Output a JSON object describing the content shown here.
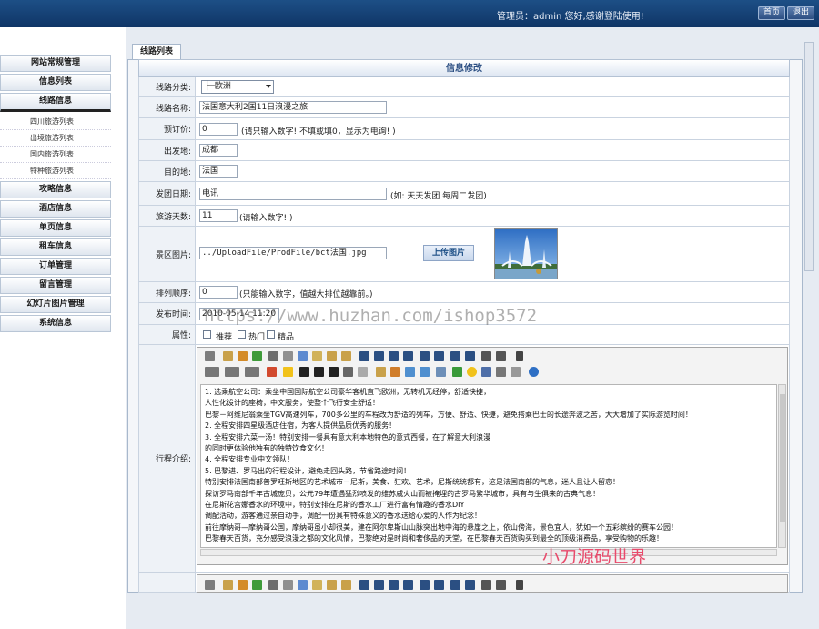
{
  "topbar": {
    "welcome": "管理员：admin 您好,感谢登陆使用!",
    "home_label": "首页",
    "exit_label": "退出"
  },
  "sidebar": {
    "groups": [
      {
        "label": "网站常规管理"
      },
      {
        "label": "信息列表"
      },
      {
        "label": "线路信息",
        "open": true,
        "subitems": [
          "四川旅游列表",
          "出境旅游列表",
          "国内旅游列表",
          "特种旅游列表"
        ]
      },
      {
        "label": "攻略信息"
      },
      {
        "label": "酒店信息"
      },
      {
        "label": "单页信息"
      },
      {
        "label": "租车信息"
      },
      {
        "label": "订单管理"
      },
      {
        "label": "留言管理"
      },
      {
        "label": "幻灯片图片管理"
      },
      {
        "label": "系统信息"
      }
    ]
  },
  "tab_label": "线路列表",
  "form_title": "信息修改",
  "fields": {
    "category": {
      "label": "线路分类:",
      "value": "├─欧洲"
    },
    "name": {
      "label": "线路名称:",
      "value": "法国意大利2国11日浪漫之旅"
    },
    "price": {
      "label": "预订价:",
      "value": "0",
      "hint": "(请只输入数字! 不填或填0，显示为电询! )"
    },
    "departure": {
      "label": "出发地:",
      "value": "成都"
    },
    "destination": {
      "label": "目的地:",
      "value": "法国"
    },
    "schedule": {
      "label": "发团日期:",
      "value": "电讯",
      "hint": "(如: 天天发团 每周二发团)"
    },
    "days": {
      "label": "旅游天数:",
      "value": "11",
      "hint": "(请输入数字! )"
    },
    "image": {
      "label": "景区图片:",
      "value": "../UploadFile/ProdFile/bct法国.jpg",
      "upload_label": "上传图片"
    },
    "order": {
      "label": "排列顺序:",
      "value": "0",
      "hint": "(只能输入数字，值越大排位越靠前。)"
    },
    "publish_time": {
      "label": "发布时间:",
      "value": "2010-05-14 11:20"
    },
    "attributes": {
      "label": "属性:",
      "options": [
        "推荐",
        "热门",
        "精品"
      ]
    },
    "intro": {
      "label": "行程介绍:"
    }
  },
  "editor_lines": [
    "1. 选乘航空公司：乘坐中国国际航空公司豪华客机直飞欧洲，无转机无经停，舒适快捷，",
    "人性化设计的座椅，中文服务，使整个飞行安全舒适！",
    "巴黎－阿维尼翁乘坐TGV高速列车，700多公里的车程改为舒适的列车，方便、舒适、快捷，避免搭乘巴士的长途奔波之苦，大大增加了实际游览时间！",
    "2. 全程安排四星级酒店住宿，为客人提供品质优秀的服务！",
    "3. 全程安排六菜一汤！特别安排一餐具有意大利本地特色的意式西餐，在了解意大利浪漫",
    "的同时更体验他独有的独特饮食文化！",
    "4. 全程安排专业中文领队！",
    "5. 巴黎进、罗马出的行程设计，避免走回头路，节省路途时间！",
    "特别安排法国南部普罗旺斯地区的艺术城市－尼斯，美食、狂欢、艺术，尼斯统统都有，这是法国南部的气息，迷人且让人留恋！",
    "探访罗马南部千年古城庞贝，公元79年遭遇猛烈喷发的维苏威火山而被掩埋的古罗马繁华城市，具有与生俱来的古典气息！",
    "在尼斯花宫娜香水的环境中，特别安排在尼斯的香水工厂进行富有情趣的香水DIY",
    "调配活动，游客通过亲自动手，调配一份具有特殊意义的香水送给心爱的人作为纪念！",
    "前往摩纳哥—摩纳哥公国，摩纳哥虽小却很美，建在阿尔卑斯山山脉突出地中海的悬崖之上，依山傍海，景色宜人，犹如一个五彩缤纷的赛车公园！",
    "巴黎春天百货，充分感受浪漫之都的文化风情，巴黎绝对是时尚和奢侈品的天堂，在巴黎春天百货购买到最全的顶级消费品，享受购物的乐趣！"
  ],
  "watermark": "https://www.huzhan.com/ishop3572",
  "watermark2": "小刀源码世界",
  "colors": {
    "topbar": "#1d4f86",
    "accent": "#2b4e82"
  }
}
